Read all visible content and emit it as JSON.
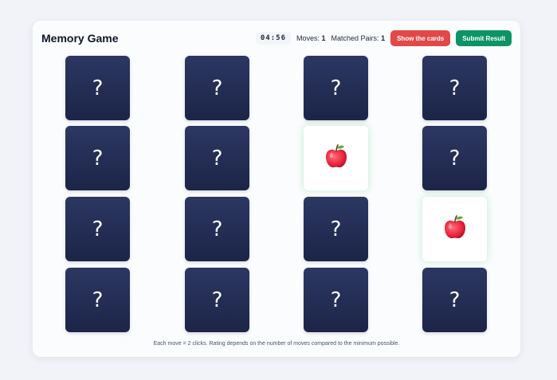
{
  "game": {
    "title": "Memory Game",
    "timer": "04:56",
    "moves_label": "Moves:",
    "moves_value": "1",
    "pairs_label": "Matched Pairs:",
    "pairs_value": "1",
    "show_button": "Show the cards",
    "submit_button": "Submit Result"
  },
  "cards": [
    {
      "state": "hidden",
      "face": "?"
    },
    {
      "state": "hidden",
      "face": "?"
    },
    {
      "state": "hidden",
      "face": "?"
    },
    {
      "state": "hidden",
      "face": "?"
    },
    {
      "state": "hidden",
      "face": "?"
    },
    {
      "state": "hidden",
      "face": "?"
    },
    {
      "state": "flipped",
      "icon": "apple-icon"
    },
    {
      "state": "hidden",
      "face": "?"
    },
    {
      "state": "hidden",
      "face": "?"
    },
    {
      "state": "hidden",
      "face": "?"
    },
    {
      "state": "hidden",
      "face": "?"
    },
    {
      "state": "flipped",
      "icon": "apple-icon"
    },
    {
      "state": "hidden",
      "face": "?"
    },
    {
      "state": "hidden",
      "face": "?"
    },
    {
      "state": "hidden",
      "face": "?"
    },
    {
      "state": "hidden",
      "face": "?"
    }
  ],
  "footer": "Each move = 2 clicks. Rating depends on the number of moves compared to the minimum possible.",
  "colors": {
    "card_back": "#2c3763",
    "show_button": "#e14949",
    "submit_button": "#0d9466"
  }
}
